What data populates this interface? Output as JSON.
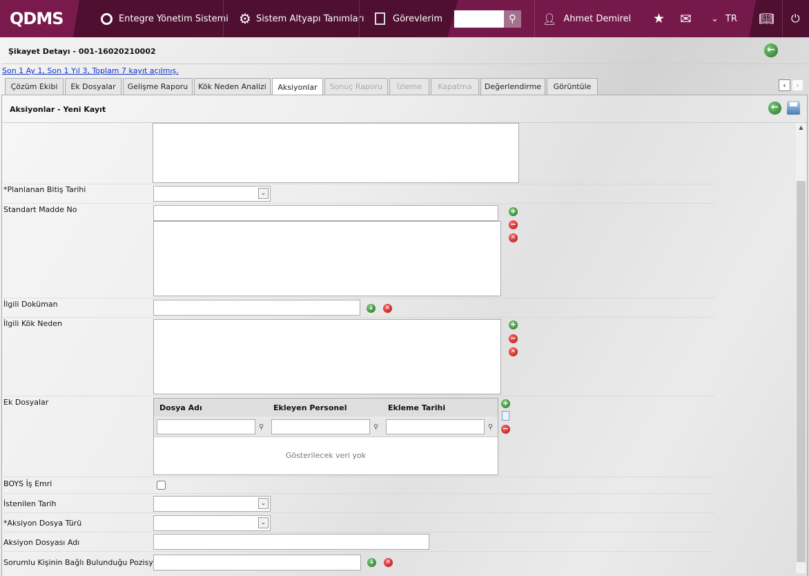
{
  "header": {
    "logo": "QDMS",
    "nav": [
      "Entegre Yönetim Sistemi",
      "Sistem Altyapı Tanımları",
      "Görevlerim"
    ],
    "search_value": "",
    "user": "Ahmet Demirel",
    "language": "TR"
  },
  "page": {
    "title": "Şikayet Detayı - 001-16020210002",
    "stats_link": "Son 1 Ay 1, Son 1 Yıl 3, Toplam 7 kayıt açılmış."
  },
  "tabs": [
    {
      "label": "Çözüm Ekibi"
    },
    {
      "label": "Ek Dosyalar"
    },
    {
      "label": "Gelişme Raporu"
    },
    {
      "label": "Kök Neden Analizi"
    },
    {
      "label": "Aksiyonlar",
      "active": true
    },
    {
      "label": "Sonuç Raporu",
      "disabled": true
    },
    {
      "label": "İzleme",
      "disabled": true
    },
    {
      "label": "Kapatma",
      "disabled": true
    },
    {
      "label": "Değerlendirme"
    },
    {
      "label": "Görüntüle"
    }
  ],
  "panel": {
    "title": "Aksiyonlar - Yeni Kayıt"
  },
  "form": {
    "planned_end": "*Planlanan Bitiş Tarihi",
    "standard_no": "Standart Madde No",
    "related_doc": "İlgili Doküman",
    "root_cause": "İlgili Kök Neden",
    "attachments": "Ek Dosyalar",
    "boys": "BOYS İş Emri",
    "requested_date": "İstenilen Tarih",
    "file_type": "*Aksiyon Dosya Türü",
    "file_name": "Aksiyon Dosyası Adı",
    "position": "Sorumlu Kişinin Bağlı Bulunduğu Pozisyon"
  },
  "grid": {
    "columns": [
      "Dosya Adı",
      "Ekleyen Personel",
      "Ekleme Tarihi"
    ],
    "empty": "Gösterilecek veri yok"
  }
}
